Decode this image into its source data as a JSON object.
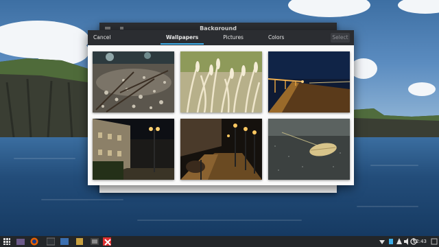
{
  "parent_window": {
    "title": "Background"
  },
  "dialog": {
    "cancel_label": "Cancel",
    "select_label": "Select",
    "tabs": [
      {
        "label": "Wallpapers",
        "active": true
      },
      {
        "label": "Pictures",
        "active": false
      },
      {
        "label": "Colors",
        "active": false
      }
    ],
    "thumbnails": [
      {
        "subject": "pebbles-and-twigs"
      },
      {
        "subject": "dry-grass"
      },
      {
        "subject": "boardwalk-at-night"
      },
      {
        "subject": "street-at-night"
      },
      {
        "subject": "waterfront-promenade"
      },
      {
        "subject": "leaf-on-asphalt"
      }
    ]
  },
  "taskbar": {
    "apps": [
      "application-menu-icon",
      "firefox-icon",
      "file-manager-icon",
      "terminal-icon",
      "image-viewer-icon",
      "screenshot-icon",
      "software-center-icon"
    ],
    "clock": "12:43",
    "tray_icons": [
      "network-icon",
      "update-icon",
      "notification-icon",
      "volume-icon",
      "power-icon"
    ]
  },
  "colors": {
    "accent": "#3daee9",
    "headerbar": "#2b2d31",
    "panel": "#232629"
  }
}
